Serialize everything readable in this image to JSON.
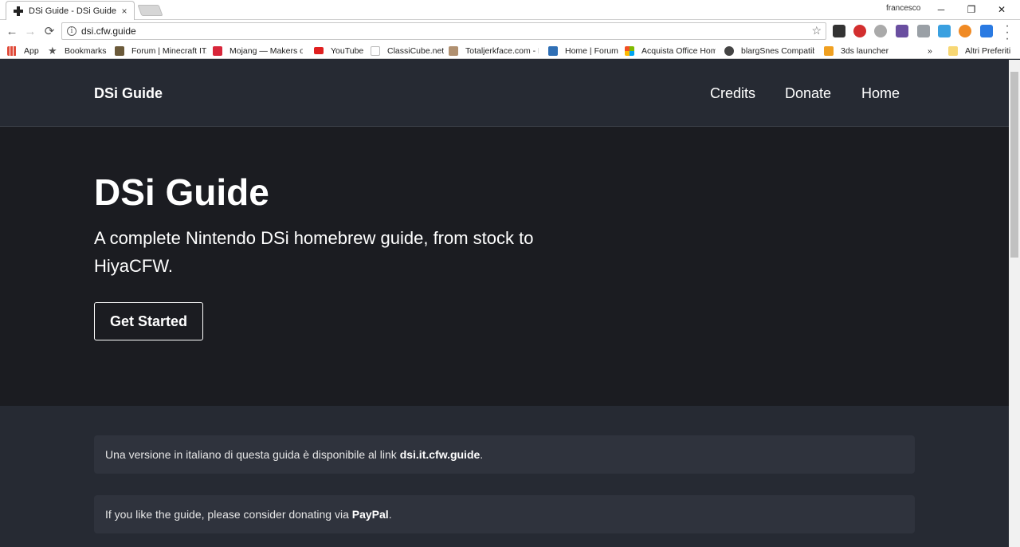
{
  "browser": {
    "tab_title": "DSi Guide - DSi Guide",
    "tab_close": "×",
    "profile_name": "francesco",
    "window_controls": {
      "minimize": "─",
      "restore": "❐",
      "close": "✕"
    },
    "url": "dsi.cfw.guide",
    "nav": {
      "back": "←",
      "forward": "→",
      "reload": "⟳"
    },
    "star": "☆",
    "info": "i",
    "bookmarks": [
      {
        "label": "App",
        "icon": "apps-grid-icon",
        "color": "#e04b3a"
      },
      {
        "label": "Bookmarks",
        "icon": "star-icon",
        "color": "#555555"
      },
      {
        "label": "Forum | Minecraft ITA",
        "icon": "minecraft-icon",
        "color": "#6b5a3a"
      },
      {
        "label": "Mojang — Makers of",
        "icon": "mojang-icon",
        "color": "#d8263a"
      },
      {
        "label": "YouTube",
        "icon": "youtube-icon",
        "color": "#e02020"
      },
      {
        "label": "ClassiCube.net",
        "icon": "cube-icon",
        "color": "#bbbbbb"
      },
      {
        "label": "Totaljerkface.com - H",
        "icon": "totaljerkface-icon",
        "color": "#b09070"
      },
      {
        "label": "Home | Forum",
        "icon": "forum-icon",
        "color": "#2f6fb5"
      },
      {
        "label": "Acquista Office Home",
        "icon": "office-icon",
        "color": "#f25022"
      },
      {
        "label": "blargSnes Compatib",
        "icon": "blargsnes-icon",
        "color": "#444444"
      },
      {
        "label": "3ds launcher",
        "icon": "launcher-icon",
        "color": "#f0a020"
      }
    ],
    "bookmarks_overflow": "»",
    "other_bookmarks": "Altri Preferiti"
  },
  "site": {
    "brand": "DSi Guide",
    "nav_links": [
      "Credits",
      "Donate",
      "Home"
    ],
    "hero_title": "DSi Guide",
    "hero_subtitle": "A complete Nintendo DSi homebrew guide, from stock to HiyaCFW.",
    "cta_label": "Get Started",
    "notice_italian_text": "Una versione in italiano di questa guida è disponibile al link ",
    "notice_italian_link": "dsi.it.cfw.guide",
    "notice_italian_end": ".",
    "notice_donate_text": "If you like the guide, please consider donating via ",
    "notice_donate_link": "PayPal",
    "notice_donate_end": "."
  },
  "colors": {
    "nav_bg": "#262a33",
    "hero_bg": "#1b1c21",
    "notice_bg": "#2f333d"
  }
}
